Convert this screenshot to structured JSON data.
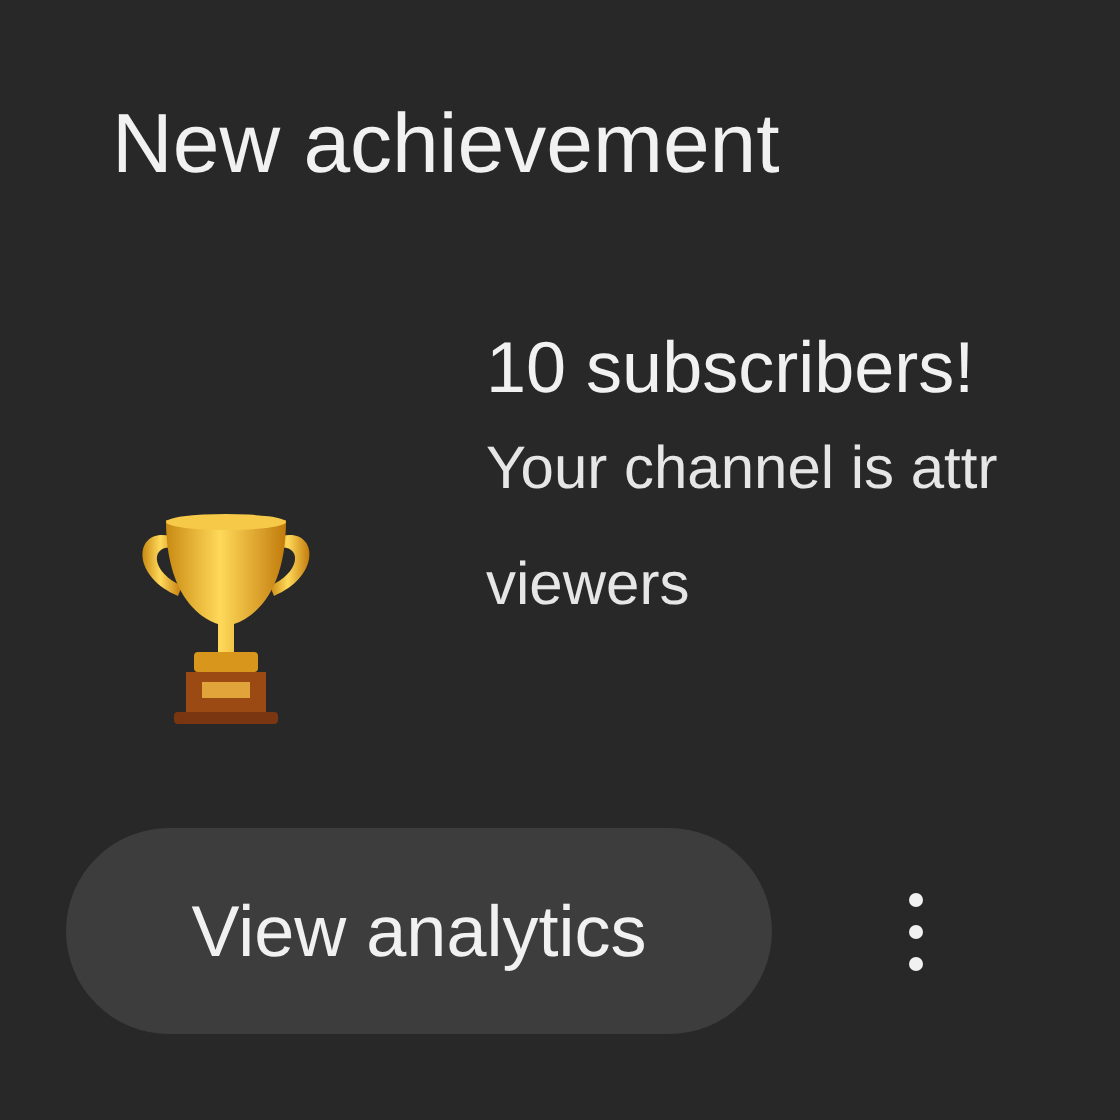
{
  "heading": "New achievement",
  "achievement": {
    "title": "10 subscribers!",
    "description_lines": [
      "Your channel is attr",
      "viewers"
    ]
  },
  "actions": {
    "button": "View analytics"
  }
}
